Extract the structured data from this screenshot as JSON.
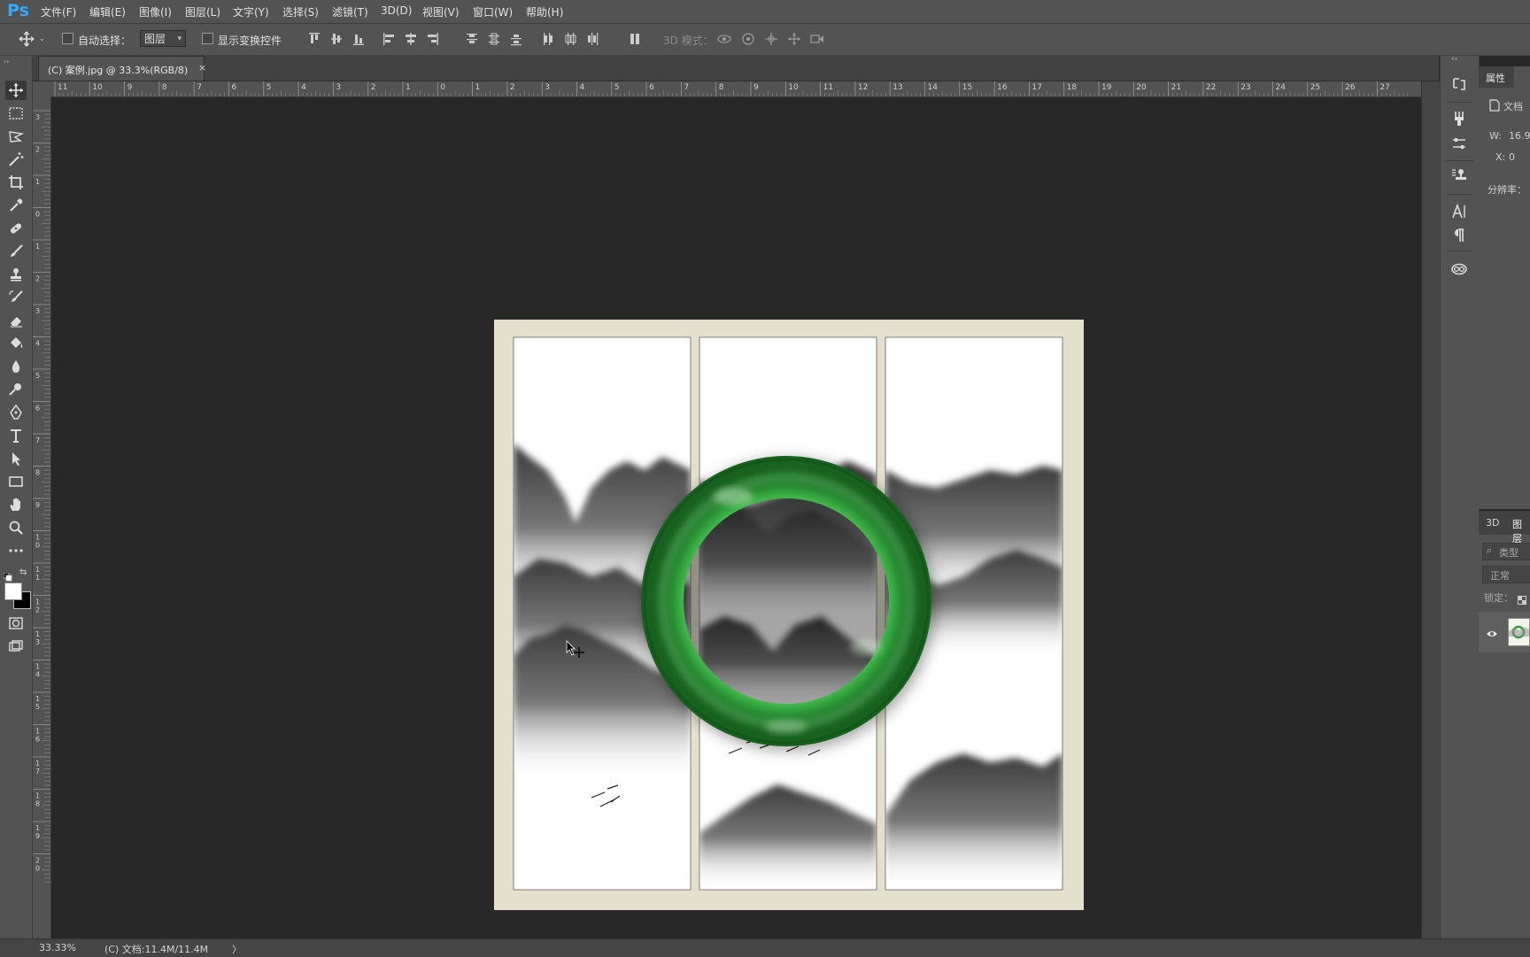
{
  "app": {
    "logo": "Ps"
  },
  "menu": [
    "文件(F)",
    "编辑(E)",
    "图像(I)",
    "图层(L)",
    "文字(Y)",
    "选择(S)",
    "滤镜(T)",
    "3D(D)",
    "视图(V)",
    "窗口(W)",
    "帮助(H)"
  ],
  "options": {
    "auto_select_label": "自动选择：",
    "auto_select_value": "图层",
    "show_transform_label": "显示变换控件",
    "mode_3d_label": "3D 模式："
  },
  "document": {
    "tab_title": "(C) 案例.jpg @ 33.3%(RGB/8)",
    "tab_close": "×"
  },
  "ruler_top_labels": [
    "11",
    "10",
    "9",
    "8",
    "7",
    "6",
    "5",
    "4",
    "3",
    "2",
    "1",
    "0",
    "1",
    "2",
    "3",
    "4",
    "5",
    "6",
    "7",
    "8",
    "9",
    "10",
    "11",
    "12",
    "13",
    "14",
    "15",
    "16",
    "17",
    "18",
    "19",
    "20",
    "21",
    "22",
    "23",
    "24",
    "25",
    "26",
    "27"
  ],
  "ruler_left_labels": [
    "3",
    "2",
    "1",
    "0",
    "1",
    "2",
    "3",
    "4",
    "5",
    "6",
    "7",
    "8",
    "9",
    "10",
    "11",
    "12",
    "13",
    "14",
    "15",
    "16",
    "17",
    "18",
    "19",
    "20"
  ],
  "status": {
    "zoom": "33.33%",
    "doc_info": "(C) 文档:11.4M/11.4M",
    "arrow": "〉"
  },
  "properties_panel": {
    "tab": "属性",
    "doc_label": "文档",
    "w_label": "W:",
    "w_value": "16.9",
    "x_label": "X:",
    "x_value": "0",
    "resolution_label": "分辨率："
  },
  "layers_panel": {
    "tab_3d": "3D",
    "tab_layers": "图层",
    "search_placeholder": "类型",
    "blend_mode": "正常",
    "lock_label": "锁定："
  },
  "colors": {
    "ui_bg": "#535353",
    "canvas_bg": "#282828",
    "artboard_frame": "#e3e1cb",
    "jade_green": "#2f9e3a",
    "accent_blue": "#31a8ff"
  },
  "icons": {
    "toolbar": [
      "move-icon",
      "marquee-icon",
      "lasso-icon",
      "magic-wand-icon",
      "crop-icon",
      "eyedropper-icon",
      "healing-brush-icon",
      "brush-icon",
      "clone-stamp-icon",
      "history-brush-icon",
      "eraser-icon",
      "paint-bucket-icon",
      "blur-icon",
      "dodge-icon",
      "pen-icon",
      "type-icon",
      "path-select-icon",
      "rectangle-icon",
      "hand-icon",
      "zoom-icon",
      "more-tools-icon"
    ],
    "dock": [
      "history-icon",
      "brush-settings-icon",
      "adjustments-icon",
      "clone-source-icon",
      "character-icon",
      "paragraph-icon",
      "creative-cloud-icon"
    ]
  }
}
